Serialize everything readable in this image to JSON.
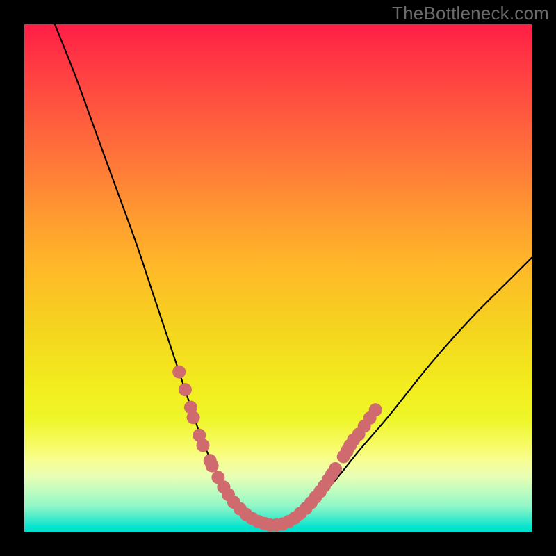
{
  "watermark": "TheBottleneck.com",
  "accent_color": "#cf6b6f",
  "curve_color": "#000000",
  "chart_data": {
    "type": "line",
    "title": "",
    "xlabel": "",
    "ylabel": "",
    "xlim": [
      0,
      100
    ],
    "ylim": [
      0,
      100
    ],
    "series": [
      {
        "name": "bottleneck-curve",
        "x": [
          6,
          10,
          14,
          18,
          22,
          25,
          27,
          29,
          31,
          32.5,
          34,
          35.5,
          37,
          38.5,
          40,
          42,
          44,
          46,
          48,
          50,
          54,
          58,
          62,
          66,
          72,
          80,
          88,
          96,
          100
        ],
        "y": [
          100,
          90,
          79,
          68,
          57,
          48,
          42,
          36,
          30,
          25.5,
          21,
          17,
          13.5,
          10.5,
          8,
          5,
          3,
          2,
          1.3,
          1.3,
          3,
          6.5,
          11,
          16,
          23,
          33,
          42,
          50,
          54
        ]
      }
    ],
    "dots": {
      "name": "highlight-segments",
      "color": "#cf6b6f",
      "points": [
        {
          "x": 30.5,
          "y": 31.5
        },
        {
          "x": 31.7,
          "y": 28.0
        },
        {
          "x": 32.8,
          "y": 24.5
        },
        {
          "x": 33.3,
          "y": 22.5
        },
        {
          "x": 34.5,
          "y": 19.0
        },
        {
          "x": 35.2,
          "y": 17.0
        },
        {
          "x": 36.6,
          "y": 14.0
        },
        {
          "x": 37.0,
          "y": 13.0
        },
        {
          "x": 38.2,
          "y": 10.7
        },
        {
          "x": 39.3,
          "y": 8.8
        },
        {
          "x": 40.2,
          "y": 7.3
        },
        {
          "x": 41.3,
          "y": 5.8
        },
        {
          "x": 42.5,
          "y": 4.5
        },
        {
          "x": 43.7,
          "y": 3.4
        },
        {
          "x": 44.9,
          "y": 2.6
        },
        {
          "x": 46.1,
          "y": 2.0
        },
        {
          "x": 47.3,
          "y": 1.6
        },
        {
          "x": 48.5,
          "y": 1.3
        },
        {
          "x": 49.7,
          "y": 1.3
        },
        {
          "x": 50.9,
          "y": 1.5
        },
        {
          "x": 52.1,
          "y": 2.0
        },
        {
          "x": 53.3,
          "y": 2.7
        },
        {
          "x": 54.4,
          "y": 3.6
        },
        {
          "x": 55.5,
          "y": 4.6
        },
        {
          "x": 56.5,
          "y": 5.7
        },
        {
          "x": 57.4,
          "y": 6.8
        },
        {
          "x": 58.3,
          "y": 7.9
        },
        {
          "x": 59.1,
          "y": 9.0
        },
        {
          "x": 59.9,
          "y": 10.2
        },
        {
          "x": 60.6,
          "y": 11.3
        },
        {
          "x": 61.3,
          "y": 12.4
        },
        {
          "x": 62.9,
          "y": 14.8
        },
        {
          "x": 63.6,
          "y": 15.9
        },
        {
          "x": 64.2,
          "y": 17.0
        },
        {
          "x": 64.9,
          "y": 18.1
        },
        {
          "x": 65.9,
          "y": 19.2
        },
        {
          "x": 67.0,
          "y": 20.8
        },
        {
          "x": 68.1,
          "y": 22.4
        },
        {
          "x": 69.2,
          "y": 24.0
        }
      ]
    }
  }
}
